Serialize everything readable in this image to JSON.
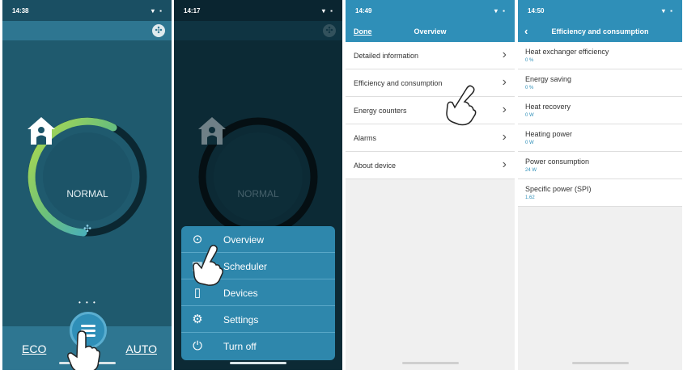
{
  "colors": {
    "panel_teal": "#1f5a6e",
    "panel_dark": "#0c2a35",
    "accent_blue": "#2f8fb8",
    "ring_green": "#9bd14b",
    "ring_blue": "#3aa8d6",
    "list_background": "#f0f0f0"
  },
  "screen1": {
    "time": "14:38",
    "status_icons": "▾ ▪",
    "mode_label": "NORMAL",
    "page_dots": "• • •",
    "eco_label": "ECO",
    "auto_label": "AUTO",
    "icons": [
      "fan-icon",
      "home-person-icon",
      "fan-small-icon",
      "menu-icon",
      "hand-pointer-icon"
    ]
  },
  "screen2": {
    "time": "14:17",
    "status_icons": "▾ ▪",
    "mode_label": "NORMAL",
    "menu_items": [
      {
        "label": "Overview",
        "icon": "overview-icon",
        "glyph": "⊙"
      },
      {
        "label": "Scheduler",
        "icon": "scheduler-icon",
        "glyph": "▦"
      },
      {
        "label": "Devices",
        "icon": "devices-icon",
        "glyph": "▯"
      },
      {
        "label": "Settings",
        "icon": "settings-icon",
        "glyph": "⚙"
      },
      {
        "label": "Turn off",
        "icon": "power-icon",
        "glyph": "⏻"
      }
    ]
  },
  "screen3": {
    "time": "14:49",
    "status_icons": "▾ ▪",
    "done_label": "Done",
    "title": "Overview",
    "items": [
      {
        "label": "Detailed information"
      },
      {
        "label": "Efficiency and consumption"
      },
      {
        "label": "Energy counters"
      },
      {
        "label": "Alarms"
      },
      {
        "label": "About device"
      }
    ]
  },
  "screen4": {
    "time": "14:50",
    "status_icons": "▾ ▪",
    "back_label": "‹",
    "title": "Efficiency and consumption",
    "items": [
      {
        "label": "Heat exchanger efficiency",
        "value": "0 %"
      },
      {
        "label": "Energy saving",
        "value": "0 %"
      },
      {
        "label": "Heat recovery",
        "value": "0 W"
      },
      {
        "label": "Heating power",
        "value": "0 W"
      },
      {
        "label": "Power consumption",
        "value": "24 W"
      },
      {
        "label": "Specific power (SPI)",
        "value": "1.62"
      }
    ]
  }
}
